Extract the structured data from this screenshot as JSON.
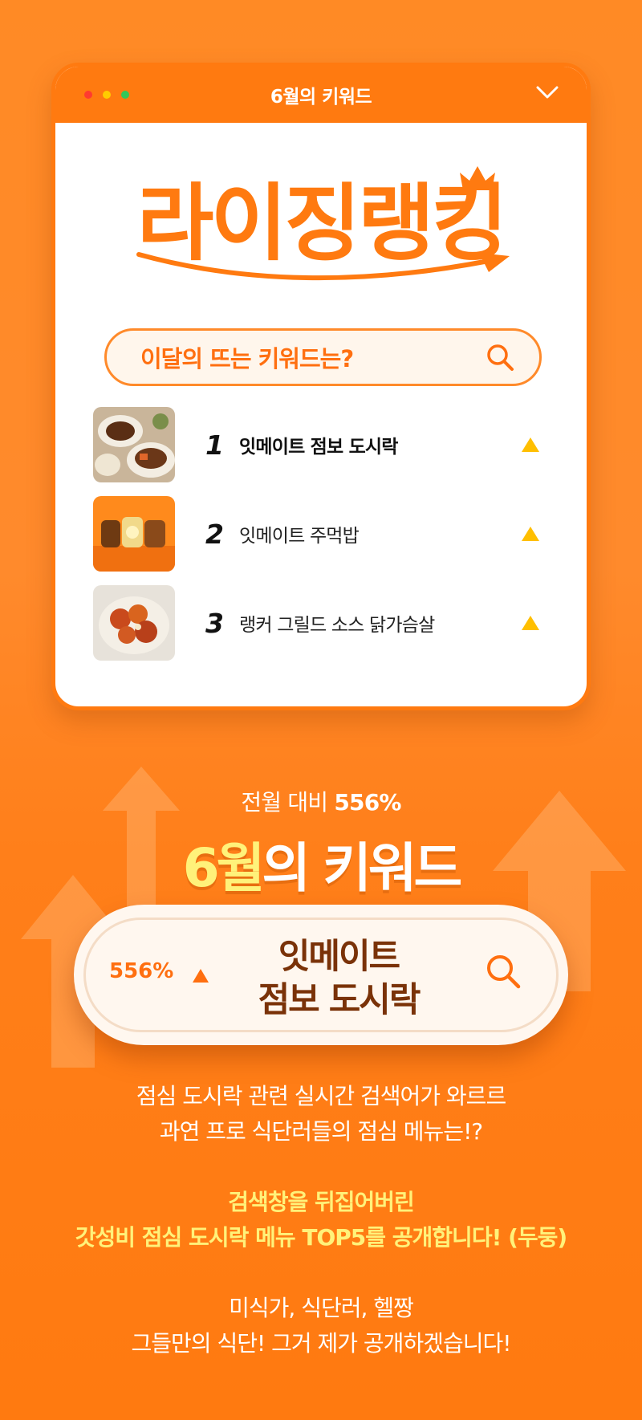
{
  "window": {
    "title": "6월의 키워드",
    "dot_colors": [
      "#ff3b30",
      "#ffcc00",
      "#34c759"
    ]
  },
  "logo": {
    "text": "라이징랭킹"
  },
  "search": {
    "placeholder": "이달의 뜨는 키워드는?"
  },
  "ranking": [
    {
      "rank": "1",
      "label": "잇메이트 점보 도시락",
      "trend": "up",
      "thumb": "food-bowl-icon"
    },
    {
      "rank": "2",
      "label": "잇메이트 주먹밥",
      "trend": "up",
      "thumb": "rice-ball-icon"
    },
    {
      "rank": "3",
      "label": "랭커 그릴드 소스 닭가슴살",
      "trend": "up",
      "thumb": "chicken-icon"
    }
  ],
  "feature": {
    "subhead_prefix": "전월 대비 ",
    "subhead_pct": "556%",
    "title_hl": "6월",
    "title_rest": "의 키워드",
    "pill_pct": "556%",
    "pill_line1": "잇메이트",
    "pill_line2": "점보 도시락"
  },
  "copy": {
    "p1_line1": "점심 도시락 관련 실시간 검색어가 와르르",
    "p1_line2": "과연 프로 식단러들의 점심 메뉴는!?",
    "p2_line1": "검색창을 뒤집어버린",
    "p2_line2": "갓성비 점심 도시락 메뉴 TOP5를 공개합니다! (두둥)",
    "p3_line1": "미식가, 식단러, 헬짱",
    "p3_line2": "그들만의 식단! 그거 제가 공개하겠습니다!"
  },
  "colors": {
    "brand_orange": "#ff7a10",
    "highlight_yellow": "#fff27a",
    "trend_yellow": "#ffbf00",
    "pill_text_brown": "#7a3208"
  }
}
